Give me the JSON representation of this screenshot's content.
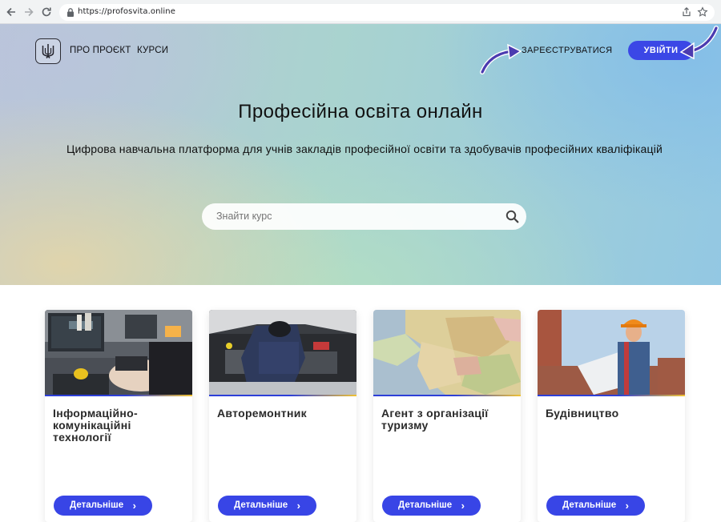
{
  "browser": {
    "url": "https://profosvita.online"
  },
  "header": {
    "nav": [
      {
        "label": "ПРО ПРОЄКТ"
      },
      {
        "label": "КУРСИ"
      }
    ],
    "register_label": "ЗАРЕЄСТРУВАТИСЯ",
    "login_label": "УВІЙТИ"
  },
  "hero": {
    "title": "Професійна освіта онлайн",
    "subtitle": "Цифрова навчальна платформа для учнів закладів професійної освіти та здобувачів професійних кваліфікацій",
    "search_placeholder": "Знайти курс"
  },
  "courses": [
    {
      "title": "Інформаційно-комунікаційні технології",
      "button": "Детальніше"
    },
    {
      "title": "Авторемонтник",
      "button": "Детальніше"
    },
    {
      "title": "Агент з організації туризму",
      "button": "Детальніше"
    },
    {
      "title": "Будівництво",
      "button": "Детальніше"
    }
  ],
  "colors": {
    "accent": "#3b47e6",
    "card_accent_line": "#2d3fd8",
    "card_accent_line_end": "#f1c232",
    "annotation_arrow": "#4b3bb0"
  },
  "icons": [
    "back-arrow-icon",
    "forward-arrow-icon",
    "reload-icon",
    "lock-icon",
    "share-icon",
    "star-icon",
    "trident-logo-icon",
    "search-icon",
    "chevron-right-icon"
  ]
}
